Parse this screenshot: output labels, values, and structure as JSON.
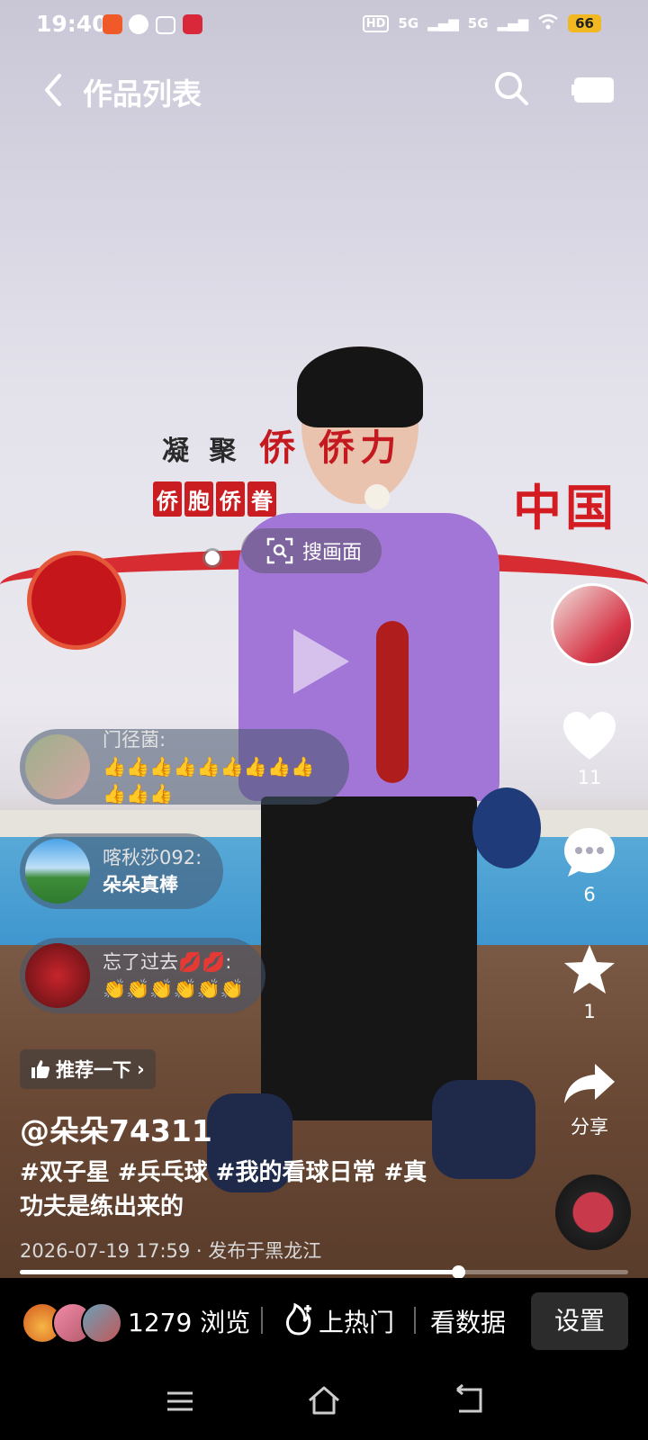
{
  "status_bar": {
    "time": "19:40",
    "hd_label": "HD",
    "signal1": "5G",
    "signal2": "5G",
    "battery": "66"
  },
  "nav": {
    "title": "作品列表",
    "back_icon": "chevron-left-icon",
    "search_icon": "search-icon",
    "camera_icon": "camera-icon"
  },
  "video": {
    "search_frame_label": "搜画面"
  },
  "comments": [
    {
      "name": "门径菌:",
      "body": "👍👍👍👍👍👍👍👍👍👍👍👍"
    },
    {
      "name": "喀秋莎092:",
      "body": "朵朵真棒"
    },
    {
      "name": "忘了过去💋💋:",
      "body": "👏👏👏👏👏👏"
    }
  ],
  "actions": {
    "likes": "11",
    "comments": "6",
    "favorites": "1",
    "share": "分享"
  },
  "post": {
    "recommend_label": "推荐一下",
    "username": "@朵朵74311",
    "caption": "#双子星 #兵乓球 #我的看球日常 #真功夫是练出来的",
    "date_location": "2026-07-19 17:59 · 发布于黑龙江",
    "progress": 0.72
  },
  "bottom_bar": {
    "views": "1279 浏览",
    "hot": "上热门",
    "data": "看数据",
    "settings": "设置"
  },
  "colors": {
    "accent": "#fe2c55",
    "battery": "#f2b822"
  }
}
